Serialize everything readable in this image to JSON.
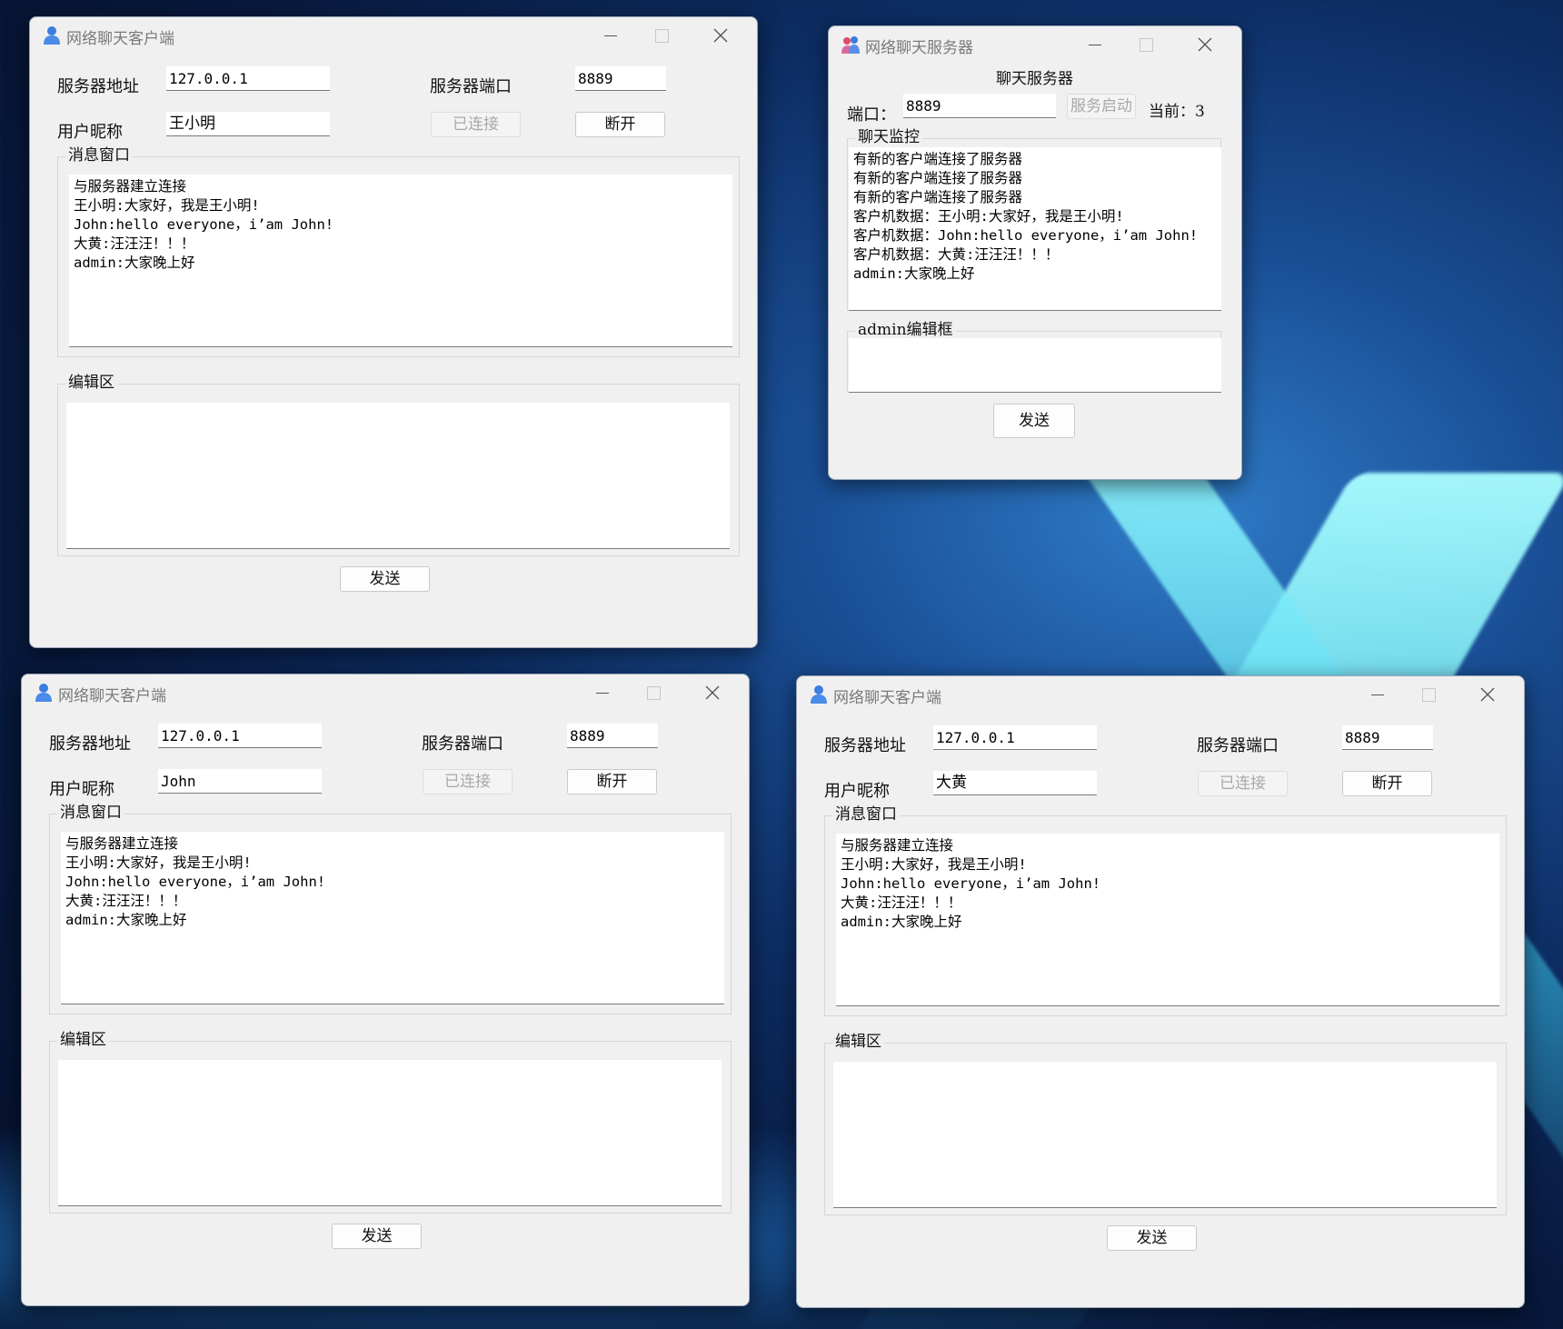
{
  "client1": {
    "title": "网络聊天客户端",
    "server_addr_label": "服务器地址",
    "server_addr": "127.0.0.1",
    "server_port_label": "服务器端口",
    "server_port": "8889",
    "nickname_label": "用户昵称",
    "nickname": "王小明",
    "connected_button": "已连接",
    "disconnect_button": "断开",
    "message_group": "消息窗口",
    "messages": [
      "与服务器建立连接",
      "王小明:大家好，我是王小明!",
      "John:hello everyone，i’am John!",
      "大黄:汪汪汪！！！",
      "admin:大家晚上好"
    ],
    "edit_group": "编辑区",
    "send_button": "发送"
  },
  "client2": {
    "title": "网络聊天客户端",
    "server_addr_label": "服务器地址",
    "server_addr": "127.0.0.1",
    "server_port_label": "服务器端口",
    "server_port": "8889",
    "nickname_label": "用户昵称",
    "nickname": "John",
    "connected_button": "已连接",
    "disconnect_button": "断开",
    "message_group": "消息窗口",
    "messages": [
      "与服务器建立连接",
      "王小明:大家好，我是王小明!",
      "John:hello everyone，i’am John!",
      "大黄:汪汪汪！！！",
      "admin:大家晚上好"
    ],
    "edit_group": "编辑区",
    "send_button": "发送"
  },
  "client3": {
    "title": "网络聊天客户端",
    "server_addr_label": "服务器地址",
    "server_addr": "127.0.0.1",
    "server_port_label": "服务器端口",
    "server_port": "8889",
    "nickname_label": "用户昵称",
    "nickname": "大黄",
    "connected_button": "已连接",
    "disconnect_button": "断开",
    "message_group": "消息窗口",
    "messages": [
      "与服务器建立连接",
      "王小明:大家好，我是王小明!",
      "John:hello everyone，i’am John!",
      "大黄:汪汪汪！！！",
      "admin:大家晚上好"
    ],
    "edit_group": "编辑区",
    "send_button": "发送"
  },
  "server": {
    "title": "网络聊天服务器",
    "heading": "聊天服务器",
    "port_label": "端口：",
    "port": "8889",
    "start_button": "服务启动",
    "current_label": "当前：3",
    "monitor_group": "聊天监控",
    "logs": [
      "有新的客户端连接了服务器",
      "有新的客户端连接了服务器",
      "有新的客户端连接了服务器",
      "客户机数据：王小明:大家好，我是王小明!",
      "客户机数据：John:hello everyone，i’am John!",
      "客户机数据：大黄:汪汪汪！！！",
      "admin:大家晚上好"
    ],
    "admin_group": "admin编辑框",
    "send_button": "发送"
  },
  "icons": {
    "client_icon": "user-icon",
    "server_icon": "users-icon",
    "window_controls": [
      "minimize-icon",
      "maximize-icon",
      "close-icon"
    ]
  },
  "colors": {
    "window_bg": "#f0f0f0",
    "desktop": "#0d2d63",
    "accent_glow": "#5fe3f0"
  }
}
